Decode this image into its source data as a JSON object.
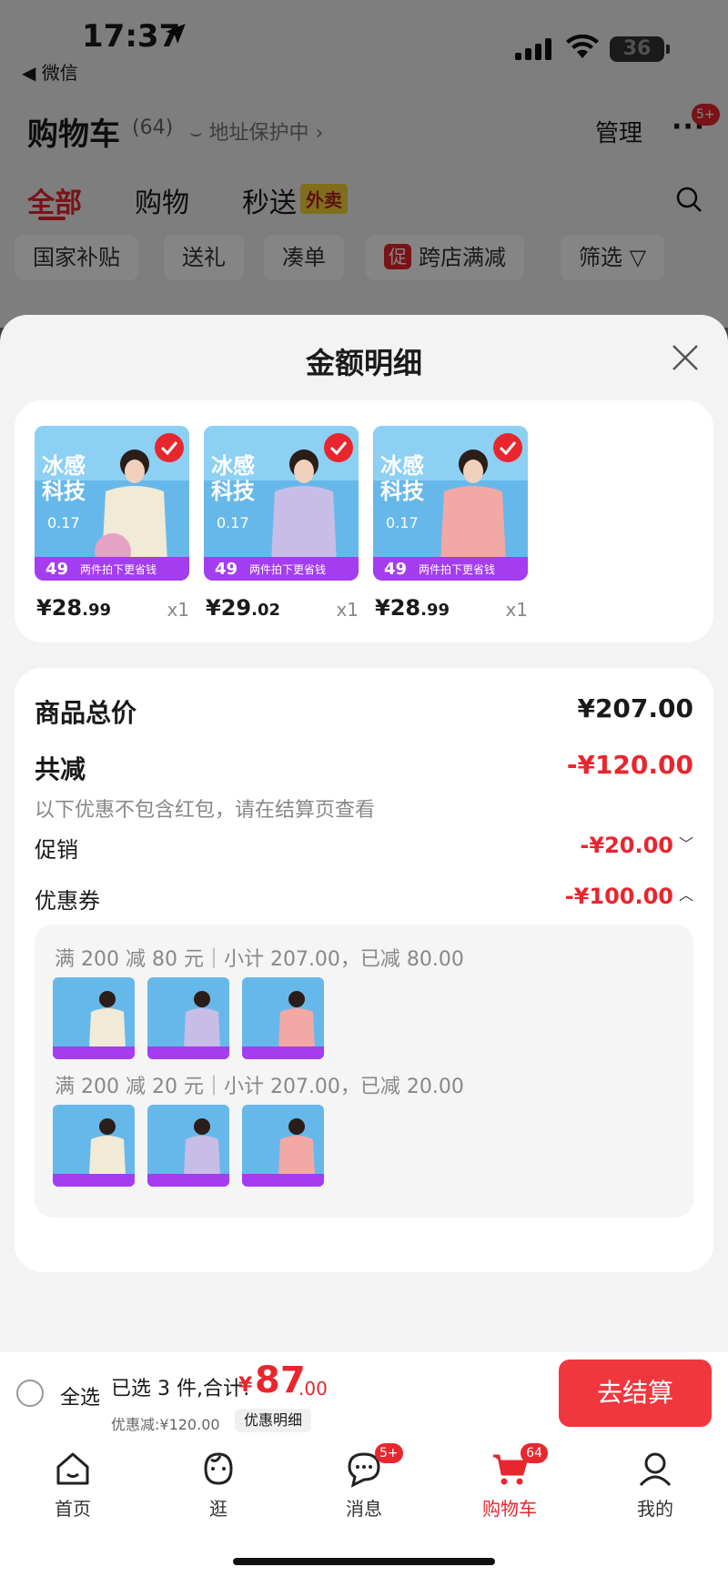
{
  "status_bar": {
    "time": "17:37",
    "back_app": "◀ 微信",
    "battery": "36"
  },
  "header": {
    "title": "购物车",
    "count": "(64)",
    "address": "⌣ 地址保护中 ›",
    "manage": "管理",
    "more_badge": "5+"
  },
  "tabs": [
    {
      "label": "全部",
      "active": true
    },
    {
      "label": "购物"
    },
    {
      "label": "秒送",
      "tag": "外卖"
    }
  ],
  "chips": [
    "国家补贴",
    "送礼",
    "凑单",
    "跨店满减",
    "筛选"
  ],
  "promo_tag": "促",
  "sheet": {
    "title": "金额明细",
    "products": [
      {
        "price_main": "¥28",
        "price_dec": ".99",
        "qty": "x1"
      },
      {
        "price_main": "¥29",
        "price_dec": ".02",
        "qty": "x1"
      },
      {
        "price_main": "¥28",
        "price_dec": ".99",
        "qty": "x1"
      }
    ],
    "product_image_text": {
      "headline_1": "冰感",
      "headline_2": "科技",
      "number": "0.17",
      "price": "49",
      "banner": "两件拍下更省钱"
    },
    "subtotal": {
      "label": "商品总价",
      "value": "¥207.00"
    },
    "total_reduce": {
      "label": "共减",
      "value": "-¥120.00",
      "note": "以下优惠不包含红包，请在结算页查看"
    },
    "promotion": {
      "label": "促销",
      "value": "-¥20.00"
    },
    "coupon": {
      "label": "优惠券",
      "value": "-¥100.00"
    },
    "coupon_lines": [
      "满 200 减 80 元｜小计 207.00，已减 80.00",
      "满 200 减 20 元｜小计 207.00，已减 20.00"
    ]
  },
  "bottom": {
    "select_all": "全选",
    "selected_text": "已选 3 件,合计:",
    "currency": "¥",
    "total_int": "87",
    "total_dec": ".00",
    "discount": "优惠减:¥120.00",
    "detail_button": "优惠明细",
    "checkout": "去结算"
  },
  "nav": [
    {
      "label": "首页",
      "icon": "home-icon"
    },
    {
      "label": "逛",
      "icon": "browse-icon"
    },
    {
      "label": "消息",
      "icon": "message-icon",
      "badge": "5+"
    },
    {
      "label": "购物车",
      "icon": "cart-icon",
      "badge": "64",
      "active": true
    },
    {
      "label": "我的",
      "icon": "profile-icon"
    }
  ],
  "colors": {
    "accent": "#e8262e",
    "sheet_bg": "#f3f3f3",
    "tag_yellow": "#f6d43a"
  }
}
